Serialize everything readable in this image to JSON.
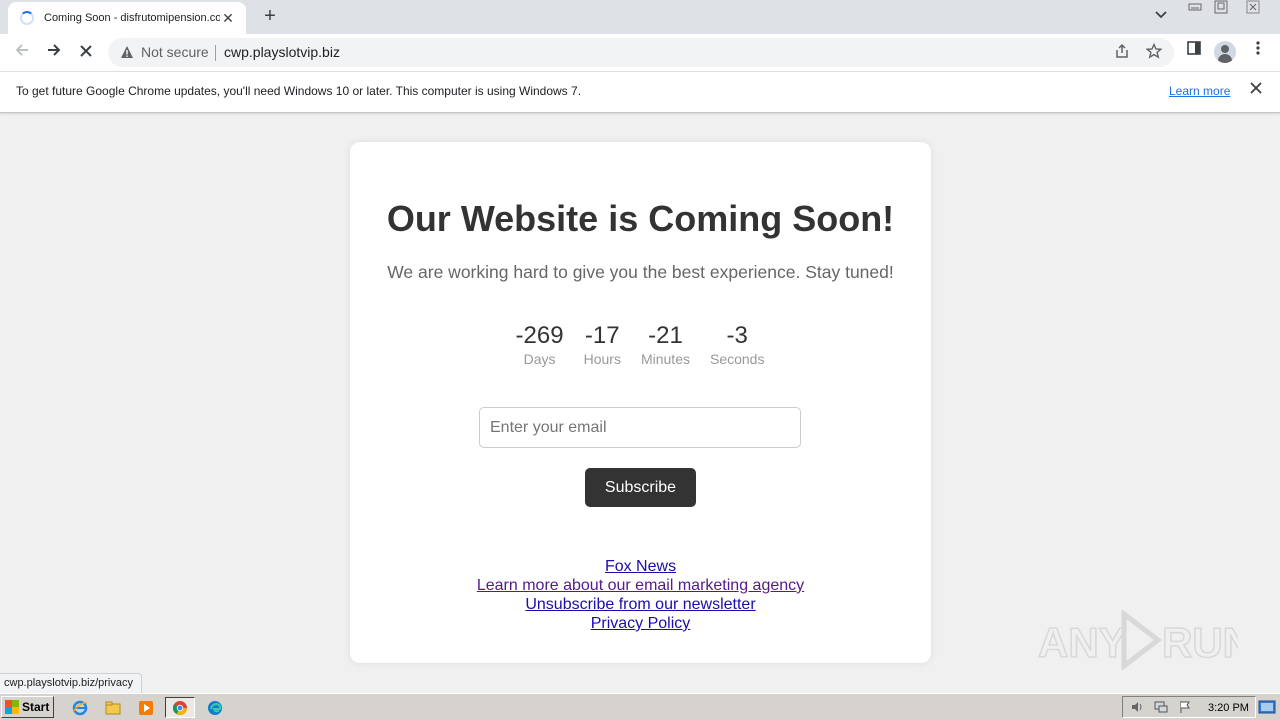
{
  "browser": {
    "tab": {
      "title": "Coming Soon - disfrutomipension.com",
      "close_glyph": "✕"
    },
    "new_tab_glyph": "+",
    "window_controls": {
      "minimize": "—",
      "restore": "❐",
      "close": "✕"
    },
    "tab_search_glyph": "⌄",
    "nav": {
      "back_glyph": "←",
      "forward_glyph": "→",
      "stop_glyph": "✕"
    },
    "security_label": "Not secure",
    "url": "cwp.playslotvip.biz",
    "menu_glyph": "⋮",
    "bookmark_glyph": "☆",
    "share_glyph": "⇪",
    "sidepanel_glyph": "▯"
  },
  "infobar": {
    "message": "To get future Google Chrome updates, you'll need Windows 10 or later. This computer is using Windows 7.",
    "learn_more": "Learn more",
    "close_glyph": "✕"
  },
  "page": {
    "title": "Our Website is Coming Soon!",
    "subtitle": "We are working hard to give you the best experience. Stay tuned!",
    "countdown": [
      {
        "value": "-269",
        "label": "Days"
      },
      {
        "value": "-17",
        "label": "Hours"
      },
      {
        "value": "-21",
        "label": "Minutes"
      },
      {
        "value": "-3",
        "label": "Seconds"
      }
    ],
    "email_placeholder": "Enter your email",
    "subscribe_label": "Subscribe",
    "links": [
      "Fox News",
      "Learn more about our email marketing agency",
      "Unsubscribe from our newsletter",
      "Privacy Policy"
    ]
  },
  "status_url": "cwp.playslotvip.biz/privacy",
  "watermark": "ANY RUN",
  "taskbar": {
    "start_label": "Start",
    "clock": "3:20 PM"
  }
}
